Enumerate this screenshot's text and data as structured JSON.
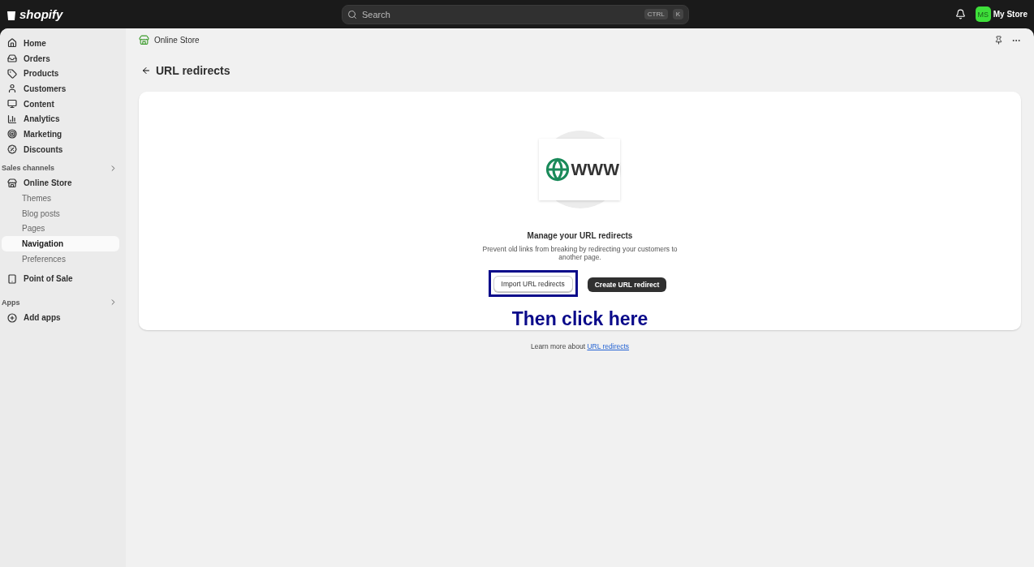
{
  "topbar": {
    "logo": "shopify",
    "search": {
      "placeholder": "Search",
      "shortcut": [
        "CTRL",
        "K"
      ]
    },
    "store": {
      "initials": "MS",
      "name": "My Store"
    }
  },
  "sidebar": {
    "items": [
      {
        "label": "Home",
        "selected": false
      },
      {
        "label": "Orders",
        "selected": false
      },
      {
        "label": "Products",
        "selected": false
      },
      {
        "label": "Customers",
        "selected": false
      },
      {
        "label": "Content",
        "selected": false
      },
      {
        "label": "Analytics",
        "selected": false
      },
      {
        "label": "Marketing",
        "selected": false
      },
      {
        "label": "Discounts",
        "selected": false
      }
    ],
    "sections": [
      {
        "title": "Sales channels",
        "items": [
          {
            "label": "Online Store",
            "selected": false,
            "children": [
              {
                "label": "Themes",
                "selected": false
              },
              {
                "label": "Blog posts",
                "selected": false
              },
              {
                "label": "Pages",
                "selected": false
              },
              {
                "label": "Navigation",
                "selected": true
              },
              {
                "label": "Preferences",
                "selected": false
              }
            ]
          },
          {
            "label": "Point of Sale",
            "selected": false
          }
        ]
      },
      {
        "title": "Apps",
        "items": [
          {
            "label": "Add apps",
            "selected": false
          }
        ]
      }
    ]
  },
  "breadcrumb": "Online Store",
  "page_title": "URL redirects",
  "empty_state": {
    "illustration_text": "WWW",
    "heading": "Manage your URL redirects",
    "description": "Prevent old links from breaking by redirecting your customers to another page.",
    "buttons": [
      {
        "label": "Import URL redirects",
        "kind": "secondary",
        "highlighted": true
      },
      {
        "label": "Create URL redirect",
        "kind": "primary",
        "highlighted": false
      }
    ],
    "annotation": "Then click here"
  },
  "footer": {
    "text": "Learn more about",
    "link": "URL redirects"
  }
}
